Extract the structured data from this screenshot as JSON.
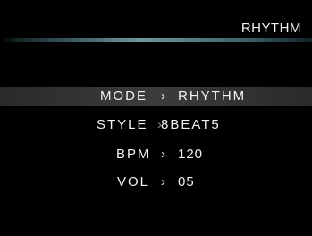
{
  "header": {
    "title": "RHYTHM"
  },
  "menu": {
    "items": [
      {
        "label": "MODE",
        "separator": "›",
        "value": "RHYTHM",
        "selected": true
      },
      {
        "label": "STYLE",
        "separator": "›",
        "value": "8BEAT5",
        "selected": false
      },
      {
        "label": "BPM",
        "separator": "›",
        "value": "120",
        "selected": false
      },
      {
        "label": "VOL",
        "separator": "›",
        "value": "05",
        "selected": false
      }
    ]
  }
}
